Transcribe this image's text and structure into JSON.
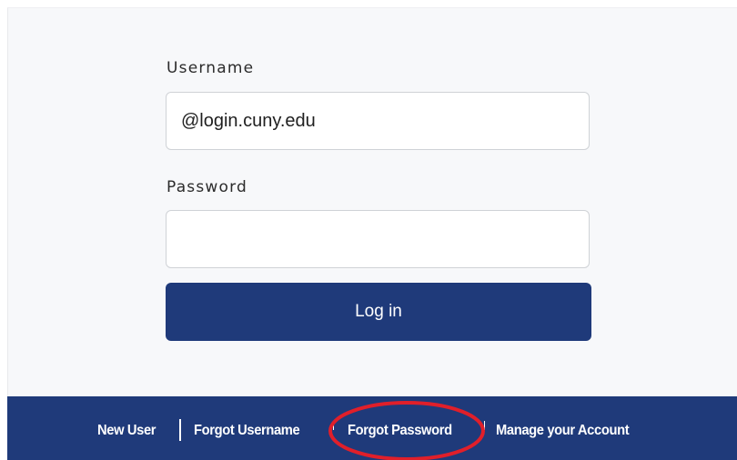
{
  "form": {
    "username_label": "Username",
    "username_value": "@login.cuny.edu",
    "password_label": "Password",
    "password_value": "",
    "login_label": "Log in"
  },
  "footer": {
    "links": [
      {
        "label": "New User"
      },
      {
        "label": "Forgot Username"
      },
      {
        "label": "Forgot Password"
      },
      {
        "label": "Manage your Account"
      }
    ]
  },
  "colors": {
    "brand_navy": "#1f3a7a",
    "panel_bg": "#f7f8fa",
    "annotation_red": "#e01f2a"
  }
}
